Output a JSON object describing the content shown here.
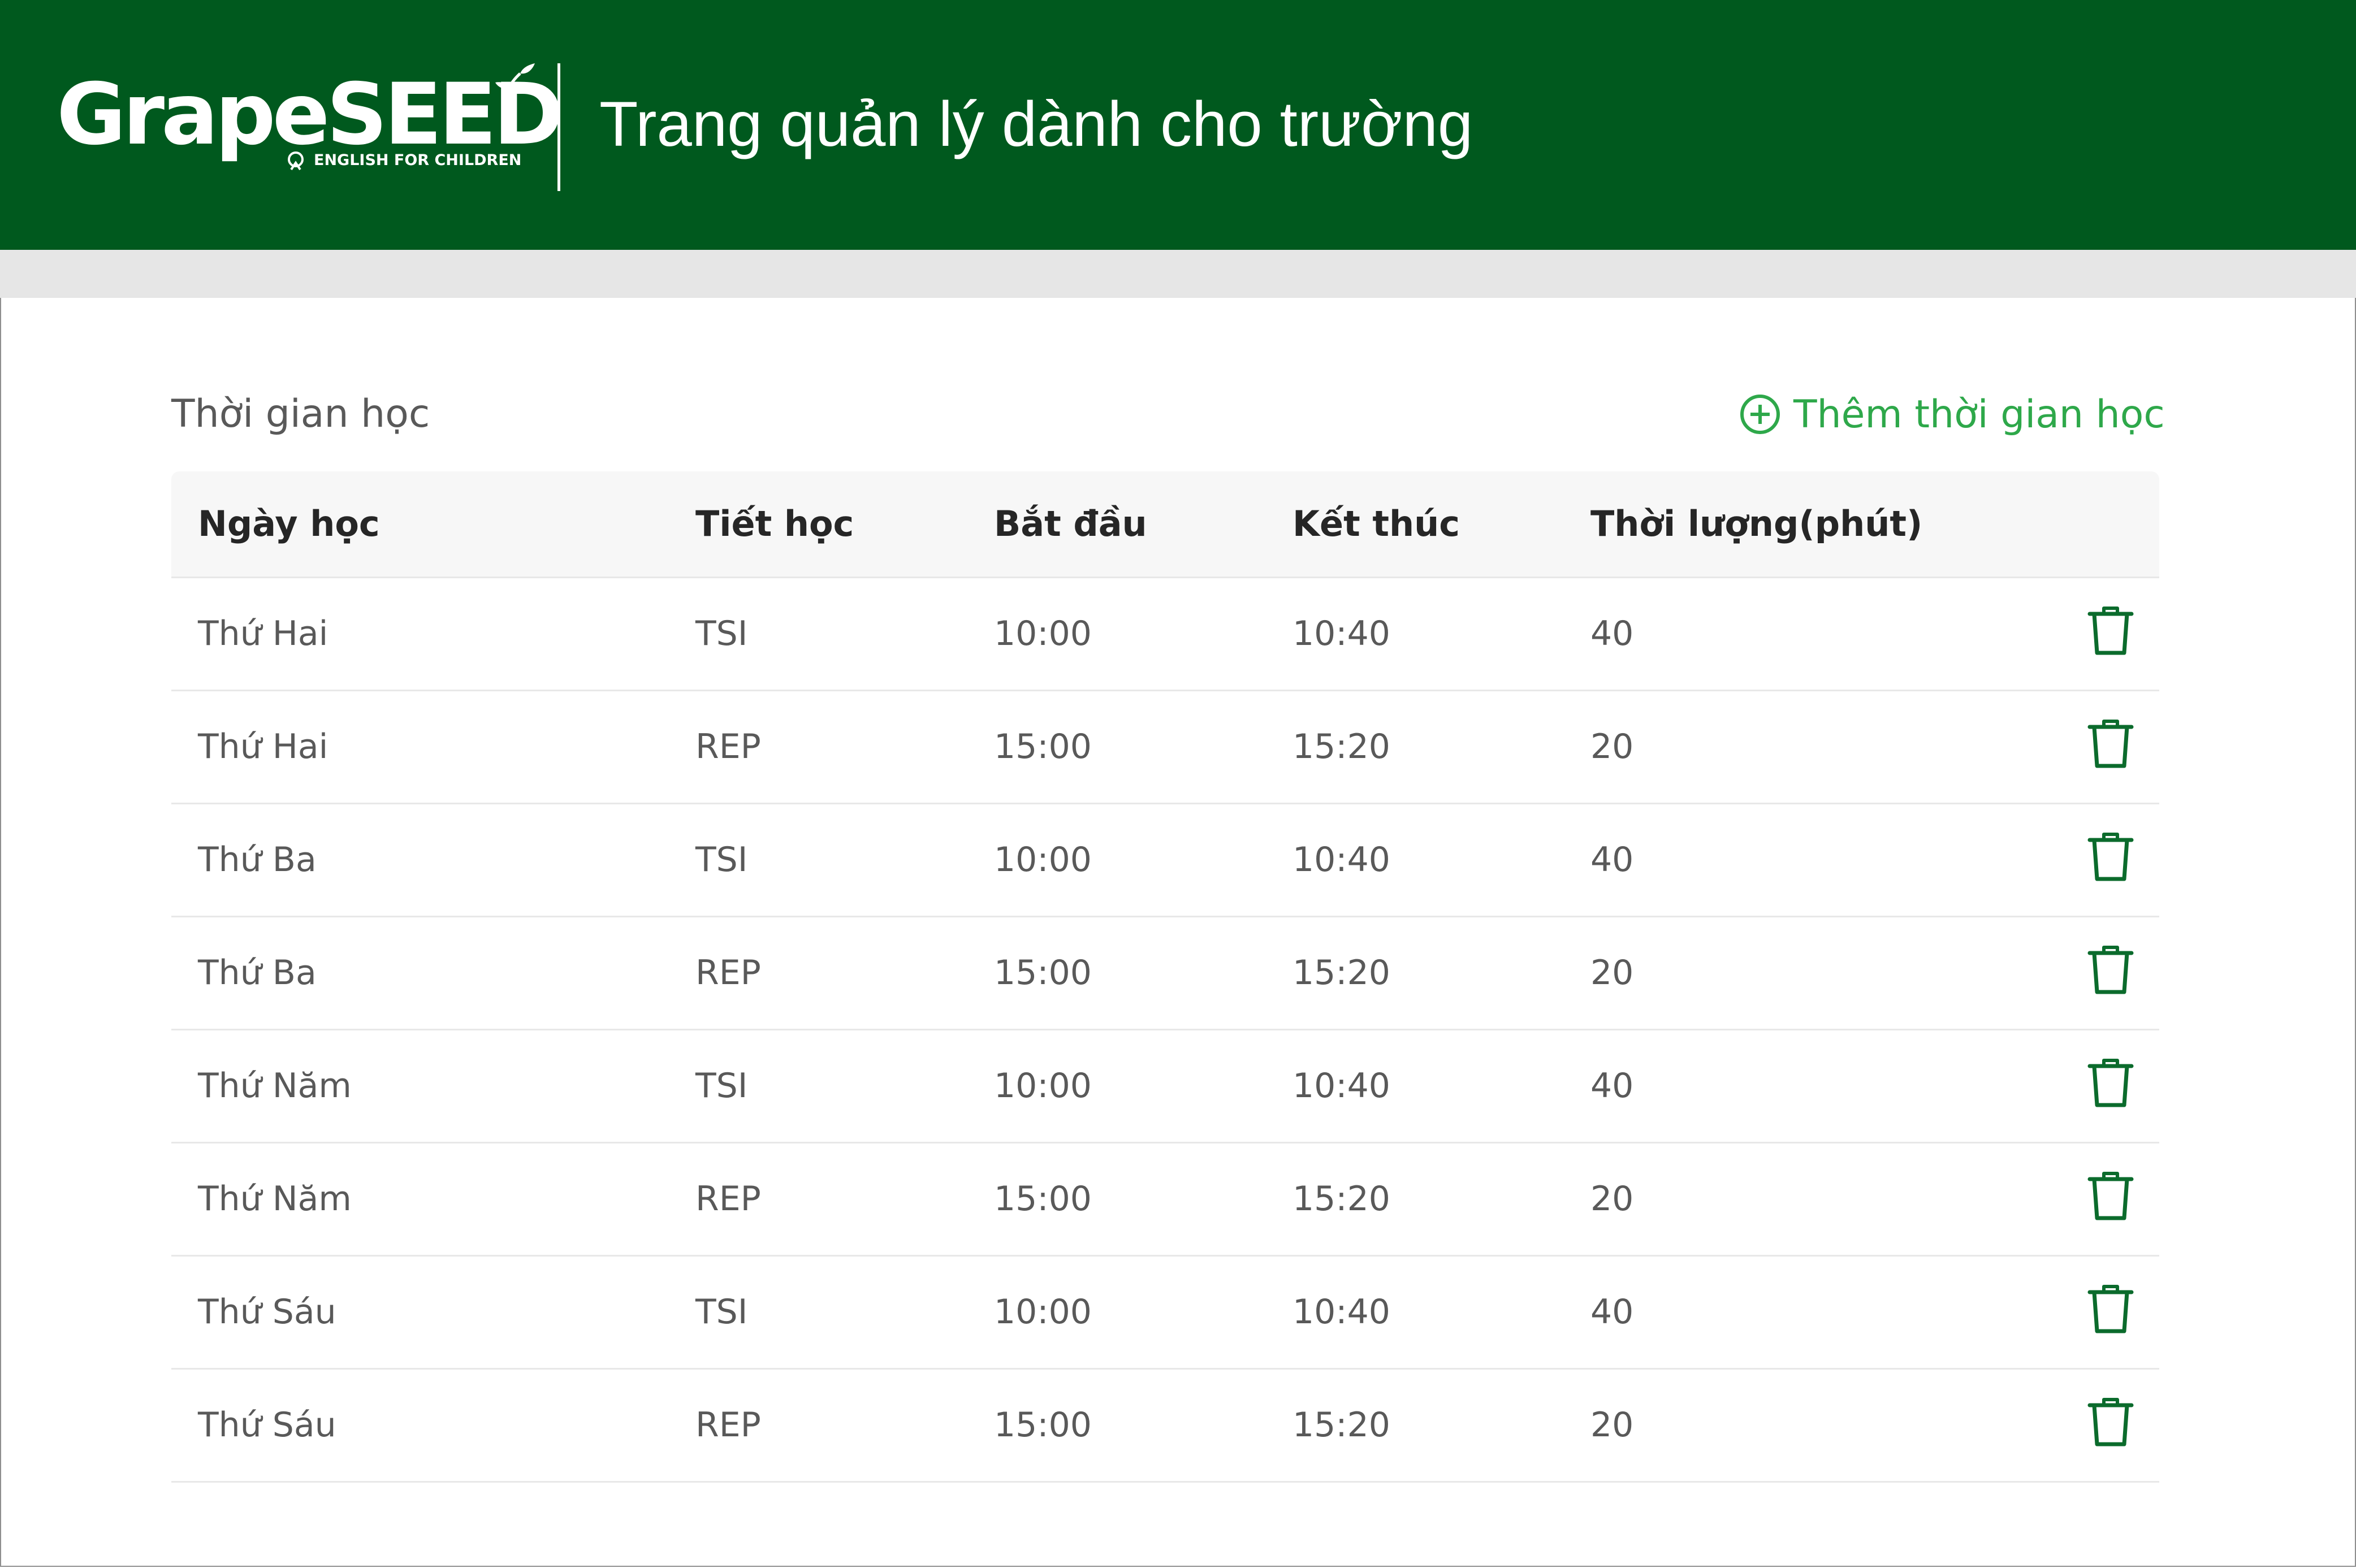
{
  "brand": {
    "logo_text": "GrapeSEED",
    "tagline": "ENGLISH FOR CHILDREN",
    "tm": "TM"
  },
  "header": {
    "title": "Trang quản lý dành cho trường"
  },
  "section": {
    "title": "Thời gian học",
    "add_label": "Thêm thời gian học",
    "add_icon": "plus-circle-icon"
  },
  "table": {
    "columns": [
      "Ngày học",
      "Tiết học",
      "Bắt đầu",
      "Kết thúc",
      "Thời lượng(phút)"
    ],
    "rows": [
      {
        "day": "Thứ Hai",
        "period": "TSI",
        "start": "10:00",
        "end": "10:40",
        "duration": "40"
      },
      {
        "day": "Thứ Hai",
        "period": "REP",
        "start": "15:00",
        "end": "15:20",
        "duration": "20"
      },
      {
        "day": "Thứ Ba",
        "period": "TSI",
        "start": "10:00",
        "end": "10:40",
        "duration": "40"
      },
      {
        "day": "Thứ Ba",
        "period": "REP",
        "start": "15:00",
        "end": "15:20",
        "duration": "20"
      },
      {
        "day": "Thứ Năm",
        "period": "TSI",
        "start": "10:00",
        "end": "10:40",
        "duration": "40"
      },
      {
        "day": "Thứ Năm",
        "period": "REP",
        "start": "15:00",
        "end": "15:20",
        "duration": "20"
      },
      {
        "day": "Thứ Sáu",
        "period": "TSI",
        "start": "10:00",
        "end": "10:40",
        "duration": "40"
      },
      {
        "day": "Thứ Sáu",
        "period": "REP",
        "start": "15:00",
        "end": "15:20",
        "duration": "20"
      }
    ],
    "row_action_icon": "trash-icon"
  },
  "colors": {
    "header_bg": "#00591e",
    "accent_green": "#2ea84a",
    "icon_green": "#0b6b2c"
  }
}
